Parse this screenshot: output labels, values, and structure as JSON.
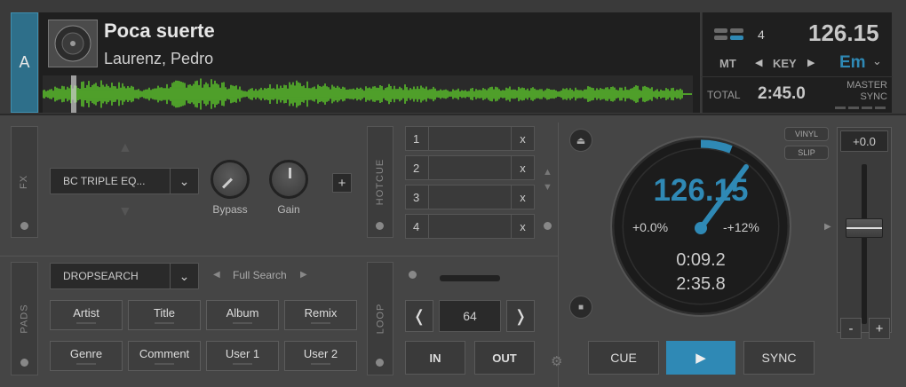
{
  "deck": {
    "letter": "A"
  },
  "track": {
    "title": "Poca suerte",
    "artist": "Laurenz, Pedro"
  },
  "info": {
    "beats": "4",
    "bpm": "126.15",
    "mt_label": "MT",
    "key_label": "KEY",
    "key_value": "Em",
    "total_label": "TOTAL",
    "total_value": "2:45.0",
    "master_label": "MASTER",
    "sync_label": "SYNC"
  },
  "fx": {
    "tab_label": "FX",
    "effect_name": "BC TRIPLE EQ...",
    "knobs": [
      {
        "label": "Bypass"
      },
      {
        "label": "Gain"
      }
    ],
    "add_label": "+"
  },
  "hotcue": {
    "tab_label": "HOTCUE",
    "slots": [
      {
        "num": "1",
        "clear": "x"
      },
      {
        "num": "2",
        "clear": "x"
      },
      {
        "num": "3",
        "clear": "x"
      },
      {
        "num": "4",
        "clear": "x"
      }
    ]
  },
  "pads": {
    "tab_label": "PADS",
    "mode": "DROPSEARCH",
    "search_mode": "Full Search",
    "buttons": [
      "Artist",
      "Title",
      "Album",
      "Remix",
      "Genre",
      "Comment",
      "User 1",
      "User 2"
    ]
  },
  "loop": {
    "tab_label": "LOOP",
    "value": "64",
    "in_label": "IN",
    "out_label": "OUT"
  },
  "jog": {
    "bpm": "126.15",
    "pitch": "+0.0%",
    "range": "-+12%",
    "elapsed": "0:09.2",
    "remaining": "2:35.8",
    "vinyl_label": "VINYL",
    "slip_label": "SLIP"
  },
  "pitch": {
    "value": "+0.0",
    "minus": "-",
    "plus": "+"
  },
  "transport": {
    "cue": "CUE",
    "play": "▶",
    "sync": "SYNC"
  },
  "colors": {
    "accent": "#2f89b5",
    "wave": "#5fd12a"
  }
}
